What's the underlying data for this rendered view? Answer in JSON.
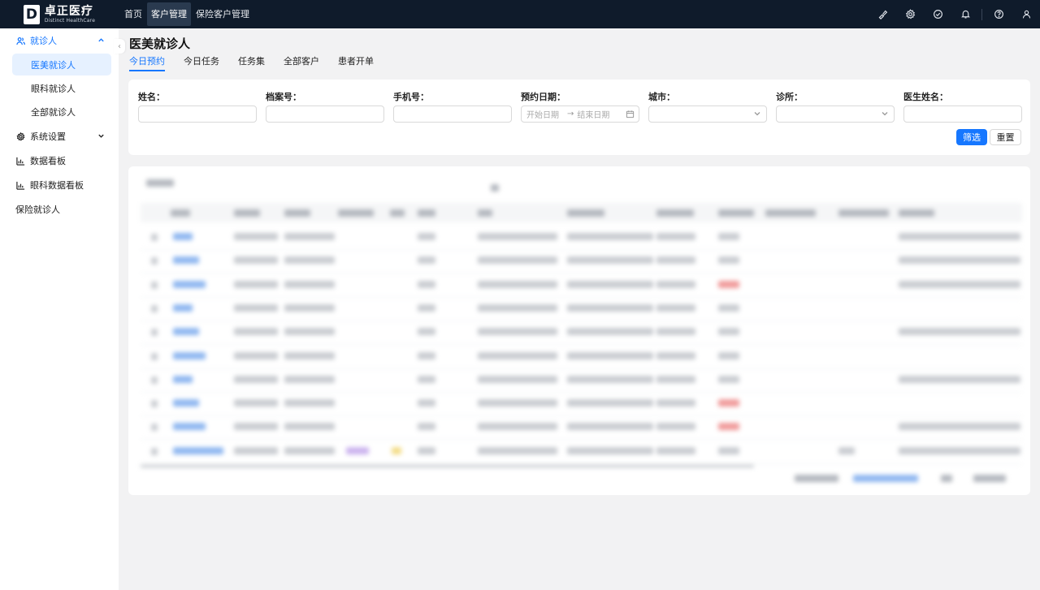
{
  "brand": {
    "logo_mark": "D",
    "name_cn": "卓正医疗",
    "name_en": "Distinct HealthCare"
  },
  "topnav": {
    "items": [
      {
        "label": "首页",
        "active": false
      },
      {
        "label": "客户管理",
        "active": true
      },
      {
        "label": "保险客户管理",
        "active": false
      }
    ],
    "icons": [
      "brush-icon",
      "settings-icon",
      "check-circle-icon",
      "bell-icon",
      "help-icon",
      "user-icon"
    ]
  },
  "sidebar": {
    "groups": [
      {
        "label": "就诊人",
        "icon": "users-icon",
        "open": true,
        "children": [
          {
            "label": "医美就诊人",
            "active": true
          },
          {
            "label": "眼科就诊人",
            "active": false
          },
          {
            "label": "全部就诊人",
            "active": false
          }
        ]
      },
      {
        "label": "系统设置",
        "icon": "settings-icon",
        "open": false
      },
      {
        "label": "数据看板",
        "icon": "bar-chart-icon"
      },
      {
        "label": "眼科数据看板",
        "icon": "bar-chart-icon"
      },
      {
        "label": "保险就诊人"
      }
    ]
  },
  "page": {
    "title": "医美就诊人",
    "tabs": [
      {
        "label": "今日预约",
        "active": true
      },
      {
        "label": "今日任务",
        "active": false
      },
      {
        "label": "任务集",
        "active": false
      },
      {
        "label": "全部客户",
        "active": false
      },
      {
        "label": "患者开单",
        "active": false
      }
    ]
  },
  "filters": {
    "name": {
      "label": "姓名：",
      "value": ""
    },
    "file_no": {
      "label": "档案号：",
      "value": ""
    },
    "phone": {
      "label": "手机号：",
      "value": ""
    },
    "date": {
      "label": "预约日期：",
      "start_placeholder": "开始日期",
      "end_placeholder": "结束日期",
      "separator": "→"
    },
    "city": {
      "label": "城市：",
      "value": ""
    },
    "clinic": {
      "label": "诊所：",
      "value": ""
    },
    "doctor": {
      "label": "医生姓名：",
      "value": ""
    },
    "submit_label": "筛选",
    "reset_label": "重置"
  },
  "colors": {
    "accent": "#1677ff",
    "topbar": "#0f1b2b",
    "active_bg": "#e6f1ff"
  }
}
